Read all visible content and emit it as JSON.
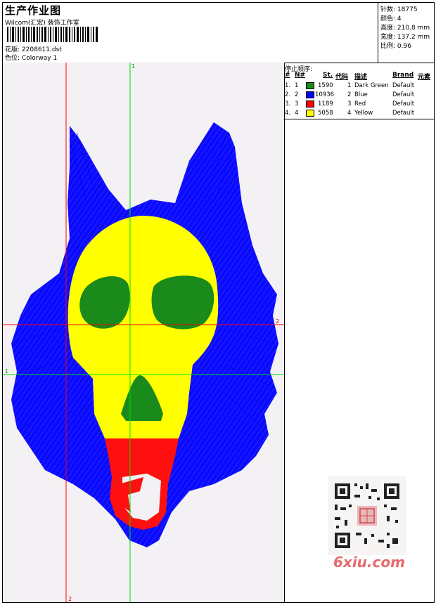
{
  "header": {
    "title": "生产作业图",
    "studio": "Wilcom(汇宏) 装饰工作室",
    "design_label": "花版:",
    "design_value": "2208611.dst",
    "colorway_label": "色位:",
    "colorway_value": "Colorway 1"
  },
  "stats": {
    "stitches_label": "针数:",
    "stitches_value": "18775",
    "colors_label": "颜色:",
    "colors_value": "4",
    "height_label": "高度:",
    "height_value": "210.8 mm",
    "width_label": "宽度:",
    "width_value": "137.2 mm",
    "scale_label": "比例:",
    "scale_value": "0.96"
  },
  "color_table": {
    "heading": "停止顺序:",
    "columns": [
      "#",
      "N#",
      "St.",
      "代码",
      "描述",
      "Brand",
      "元素"
    ],
    "rows": [
      {
        "idx": "1.",
        "n": "1",
        "color": "#1a8a1a",
        "st": "1590",
        "code": "1",
        "desc": "Dark Green",
        "brand": "Default"
      },
      {
        "idx": "2.",
        "n": "2",
        "color": "#0000ff",
        "st": "10936",
        "code": "2",
        "desc": "Blue",
        "brand": "Default"
      },
      {
        "idx": "3.",
        "n": "3",
        "color": "#ff0000",
        "st": "1189",
        "code": "3",
        "desc": "Red",
        "brand": "Default"
      },
      {
        "idx": "4.",
        "n": "4",
        "color": "#ffff00",
        "st": "5058",
        "code": "4",
        "desc": "Yellow",
        "brand": "Default"
      }
    ]
  },
  "guides": {
    "v_green_label": "1",
    "h_green_label": "1",
    "h_red_label": "2",
    "v_red_label": "2"
  },
  "watermark": {
    "text": "6xiu.com"
  }
}
